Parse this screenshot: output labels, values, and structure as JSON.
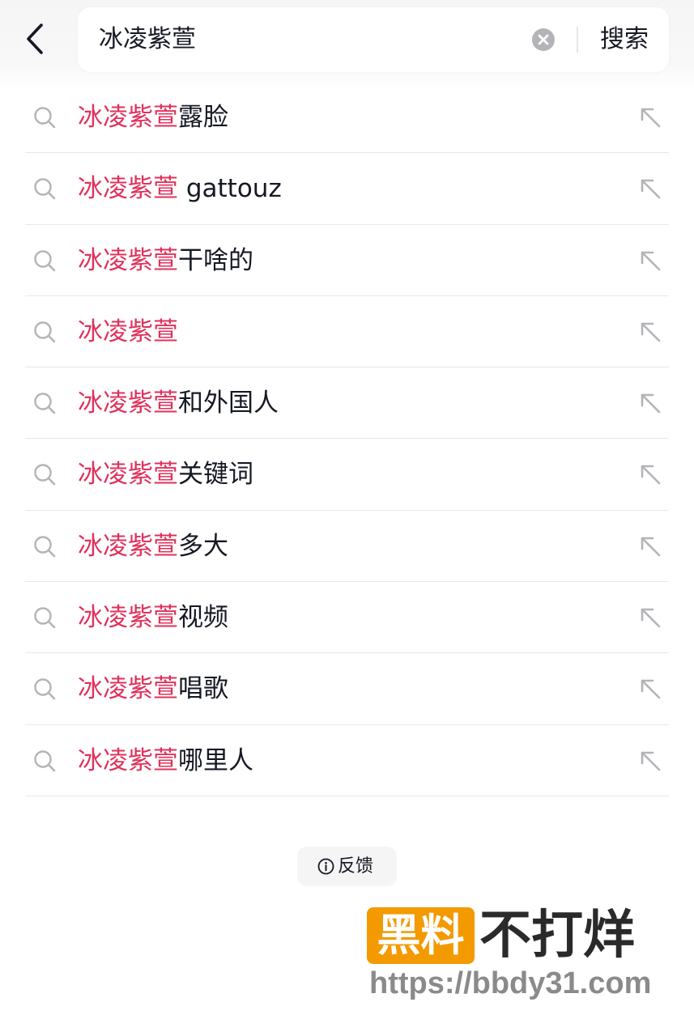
{
  "header": {
    "back_icon": "chevron-left-icon",
    "query": "冰凌紫萱",
    "clear_icon": "clear-circle-icon",
    "search_label": "搜索"
  },
  "suggestions": [
    {
      "highlight": "冰凌紫萱",
      "rest": "露脸"
    },
    {
      "highlight": "冰凌紫萱",
      "rest": " gattouz"
    },
    {
      "highlight": "冰凌紫萱",
      "rest": "干啥的"
    },
    {
      "highlight": "冰凌紫萱",
      "rest": ""
    },
    {
      "highlight": "冰凌紫萱",
      "rest": "和外国人"
    },
    {
      "highlight": "冰凌紫萱",
      "rest": "关键词"
    },
    {
      "highlight": "冰凌紫萱",
      "rest": "多大"
    },
    {
      "highlight": "冰凌紫萱",
      "rest": "视频"
    },
    {
      "highlight": "冰凌紫萱",
      "rest": "唱歌"
    },
    {
      "highlight": "冰凌紫萱",
      "rest": "哪里人"
    }
  ],
  "feedback": {
    "label": "反馈",
    "icon": "info-icon"
  },
  "watermark": {
    "box_text": "黑料",
    "text": "不打烊",
    "url": "https://bbdy31.com"
  },
  "colors": {
    "highlight": "#e0315b",
    "text": "#161823",
    "icon": "#b4b4b8",
    "accent": "#f39a00"
  }
}
